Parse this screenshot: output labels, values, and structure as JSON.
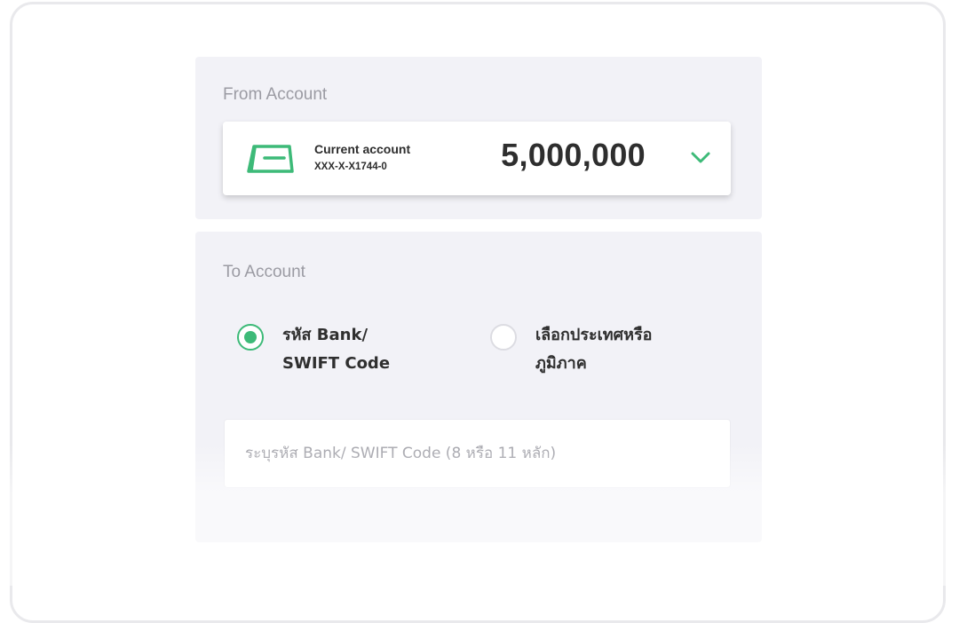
{
  "from_section": {
    "label": "From Account",
    "account": {
      "name": "Current account",
      "number": "XXX-X-X1744-0",
      "balance": "5,000,000",
      "icon": "card-icon",
      "dropdown_icon": "chevron-down-icon"
    }
  },
  "to_section": {
    "label": "To Account",
    "options": [
      {
        "line1": "รหัส Bank/",
        "line2": "SWIFT Code",
        "selected": true
      },
      {
        "line1": "เลือกประเทศหรือ",
        "line2": "ภูมิภาค",
        "selected": false
      }
    ],
    "input": {
      "placeholder": "ระบุรหัส Bank/ SWIFT Code (8 หรือ 11 หลัก)",
      "value": ""
    }
  },
  "colors": {
    "accent": "#3dba78",
    "panel_bg": "#f2f2f7",
    "label_gray": "#9b9ba3",
    "text_dark": "#2e2e2e"
  }
}
